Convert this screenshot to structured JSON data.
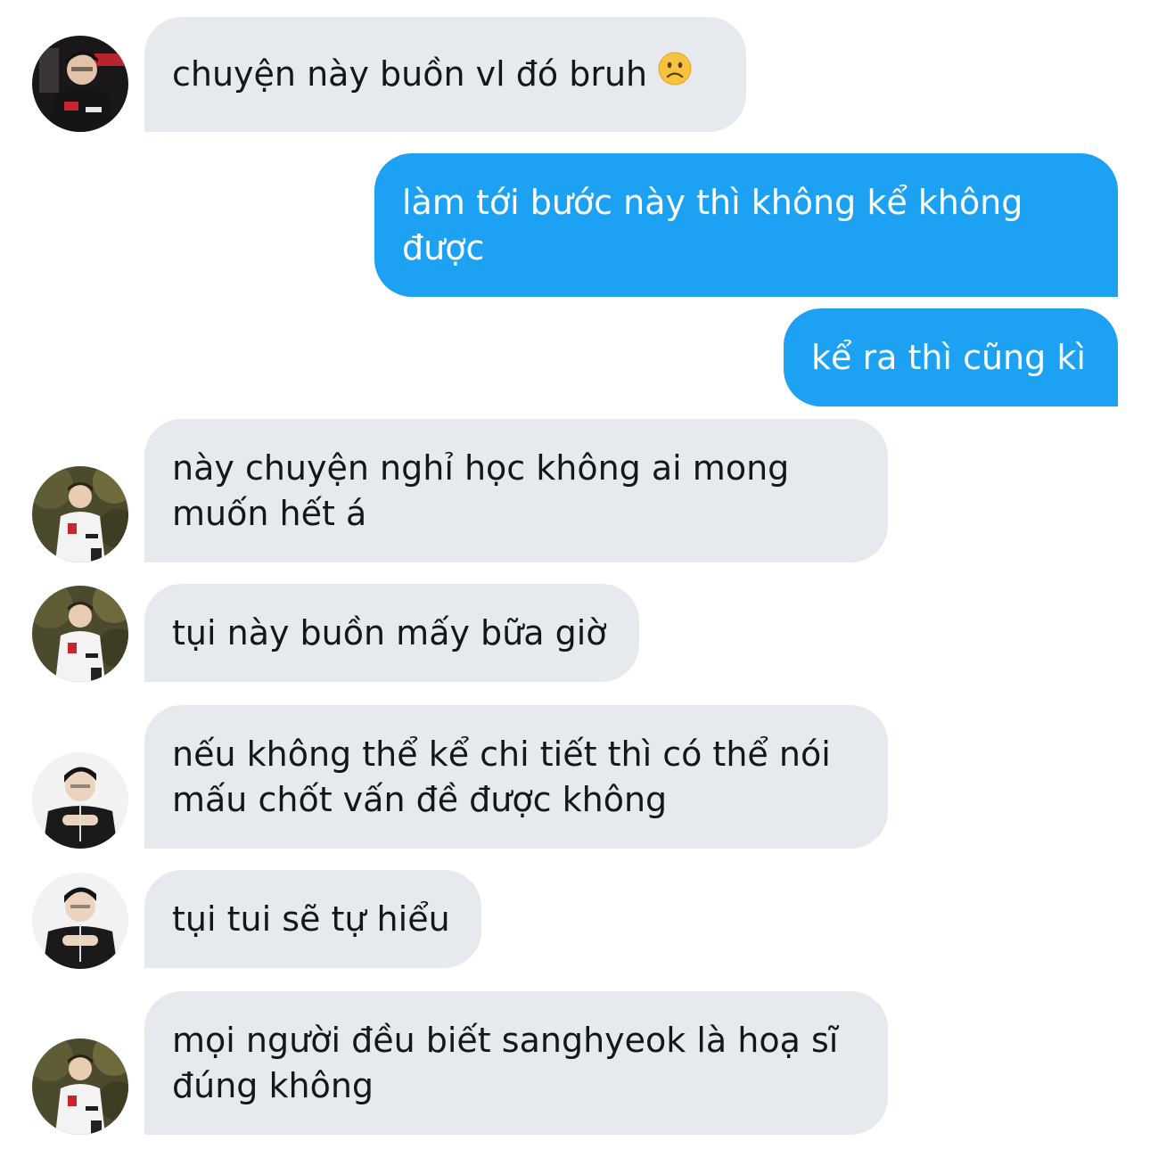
{
  "messages": [
    {
      "direction": "in",
      "text": "chuyện này buồn vl đó bruh",
      "emoji": "slightly-frowning-face-icon",
      "avatar": "avatar-gaming-chair"
    },
    {
      "direction": "out",
      "text": "làm tới bước này thì không kể không\nđược"
    },
    {
      "direction": "out",
      "text": "kể ra thì cũng kì"
    },
    {
      "direction": "in",
      "text": "này chuyện nghỉ học không ai mong\nmuốn hết á",
      "avatar": "avatar-outdoor-white-jacket"
    },
    {
      "direction": "in",
      "text": "tụi này buồn mấy bữa giờ",
      "avatar": "avatar-outdoor-white-jacket"
    },
    {
      "direction": "in",
      "text": "nếu không thể kể chi tiết thì có thể nói\nmấu chốt vấn đề được không",
      "avatar": "avatar-black-shirt-studio"
    },
    {
      "direction": "in",
      "text": "tụi tui sẽ tự hiểu",
      "avatar": "avatar-black-shirt-studio"
    },
    {
      "direction": "in",
      "text": "mọi người đều biết sanghyeok là hoạ sĩ\nđúng không",
      "avatar": "avatar-outdoor-white-jacket"
    }
  ],
  "colors": {
    "incoming_bubble": "#e6e9ee",
    "outgoing_bubble": "#1da1f2",
    "incoming_text": "#14171a",
    "outgoing_text": "#ffffff"
  }
}
